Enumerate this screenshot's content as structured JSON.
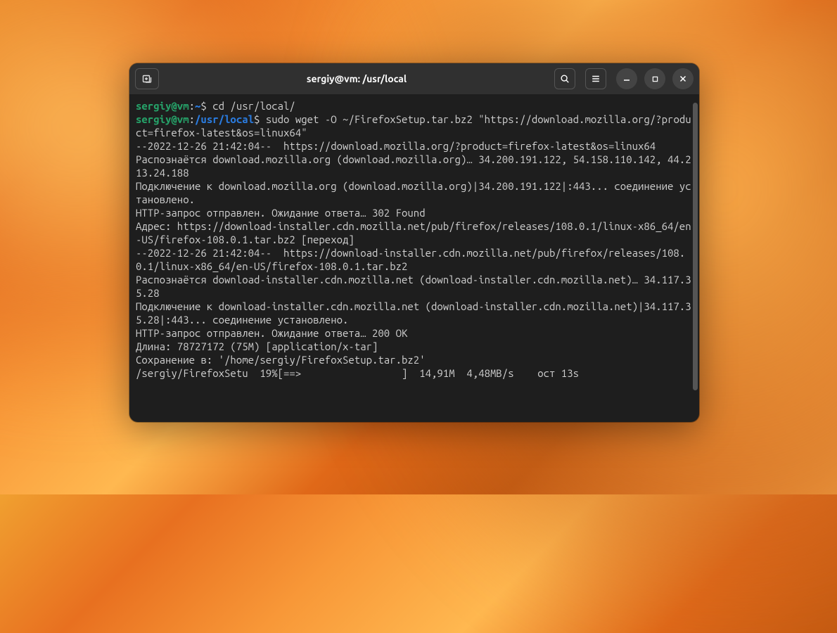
{
  "window": {
    "title": "sergiy@vm: /usr/local"
  },
  "prompt1": {
    "user": "sergiy@vm",
    "colon": ":",
    "path": "~",
    "dollar": "$",
    "cmd": " cd /usr/local/"
  },
  "prompt2": {
    "user": "sergiy@vm",
    "colon": ":",
    "path": "/usr/local",
    "dollar": "$",
    "cmd": " sudo wget -O ~/FirefoxSetup.tar.bz2 \"https://download.mozilla.org/?product=firefox-latest&os=linux64\""
  },
  "out": {
    "l1": "--2022-12-26 21:42:04--  https://download.mozilla.org/?product=firefox-latest&os=linux64",
    "l2": "Распознаётся download.mozilla.org (download.mozilla.org)… 34.200.191.122, 54.158.110.142, 44.213.24.188",
    "l3": "Подключение к download.mozilla.org (download.mozilla.org)|34.200.191.122|:443... соединение установлено.",
    "l4": "HTTP-запрос отправлен. Ожидание ответа… 302 Found",
    "l5": "Адрес: https://download-installer.cdn.mozilla.net/pub/firefox/releases/108.0.1/linux-x86_64/en-US/firefox-108.0.1.tar.bz2 [переход]",
    "l6": "--2022-12-26 21:42:04--  https://download-installer.cdn.mozilla.net/pub/firefox/releases/108.0.1/linux-x86_64/en-US/firefox-108.0.1.tar.bz2",
    "l7": "Распознаётся download-installer.cdn.mozilla.net (download-installer.cdn.mozilla.net)… 34.117.35.28",
    "l8": "Подключение к download-installer.cdn.mozilla.net (download-installer.cdn.mozilla.net)|34.117.35.28|:443... соединение установлено.",
    "l9": "HTTP-запрос отправлен. Ожидание ответа… 200 OK",
    "l10": "Длина: 78727172 (75M) [application/x-tar]",
    "l11": "Сохранение в: '/home/sergiy/FirefoxSetup.tar.bz2'",
    "blank": "",
    "progress": "/sergiy/FirefoxSetu  19%[==>                 ]  14,91M  4,48MB/s    ост 13s"
  }
}
